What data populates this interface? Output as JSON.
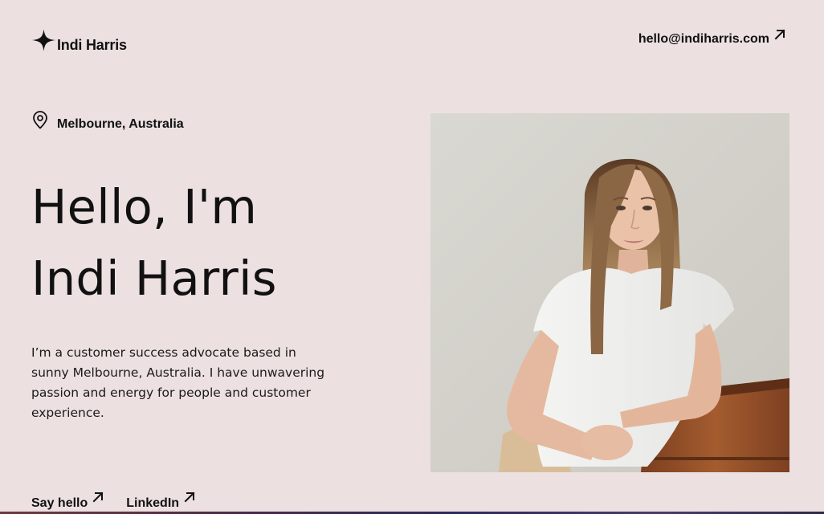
{
  "header": {
    "logo_name": "Indi Harris",
    "email": "hello@indiharris.com",
    "logo_icon": "sparkle-icon",
    "email_arrow_icon": "arrow-up-right-icon"
  },
  "hero": {
    "location": "Melbourne, Australia",
    "location_icon": "map-pin-icon",
    "headline_line1": "Hello, I'm",
    "headline_line2": "Indi Harris",
    "bio": "I’m a customer success advocate based in sunny Melbourne, Australia. I have unwavering passion and energy for people and customer experience."
  },
  "links": {
    "say_hello": "Say hello",
    "linkedin": "LinkedIn",
    "arrow_icon": "arrow-up-right-icon"
  },
  "colors": {
    "background": "#ece0e0",
    "text": "#111111"
  }
}
